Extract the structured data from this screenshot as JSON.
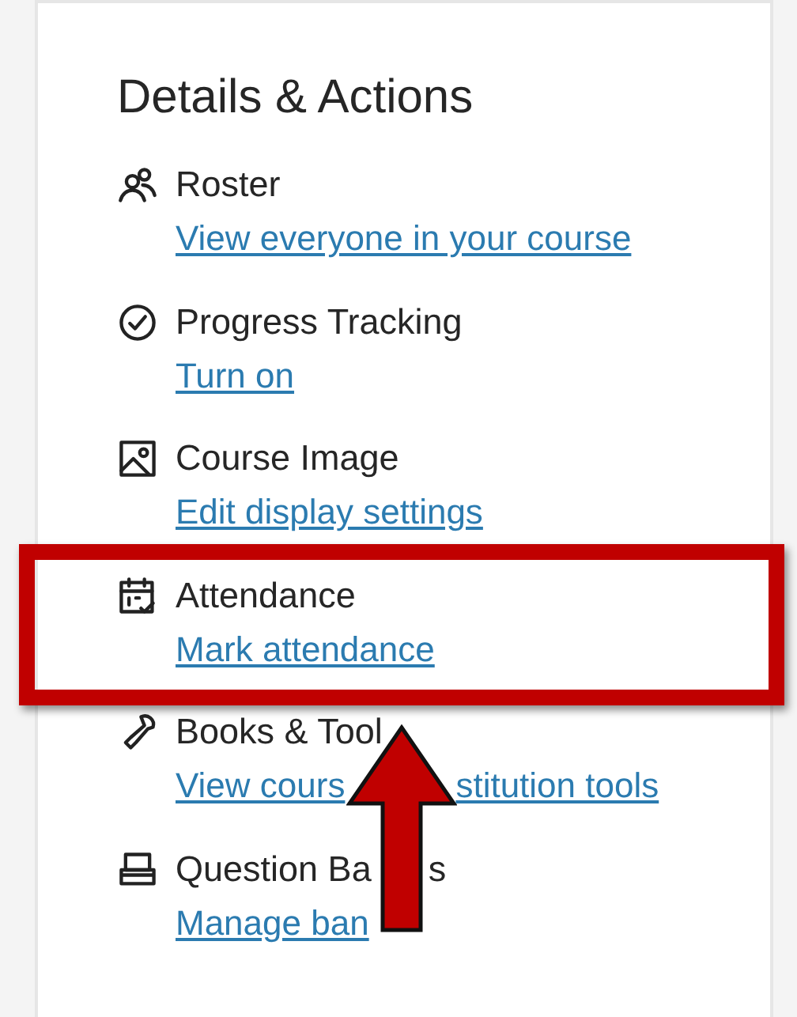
{
  "panel": {
    "title": "Details & Actions"
  },
  "items": [
    {
      "kind": "roster",
      "title": [
        "Roster"
      ],
      "link": [
        "View everyone in your course"
      ],
      "highlighted": false
    },
    {
      "kind": "progress",
      "title": [
        "Progress Tracking"
      ],
      "link": [
        "Turn on"
      ],
      "highlighted": false
    },
    {
      "kind": "image",
      "title": [
        "Course Image"
      ],
      "link": [
        "Edit display settings"
      ],
      "highlighted": false
    },
    {
      "kind": "attendance",
      "title": [
        "Attendance"
      ],
      "link": [
        "Mark attendance"
      ],
      "highlighted": true
    },
    {
      "kind": "tools",
      "title": [
        "Books & Tool"
      ],
      "link": [
        "View cours",
        "stitution tools"
      ],
      "highlighted": false
    },
    {
      "kind": "banks",
      "title": [
        "Question Ba",
        "s"
      ],
      "link": [
        "Manage ban"
      ],
      "highlighted": false
    }
  ]
}
